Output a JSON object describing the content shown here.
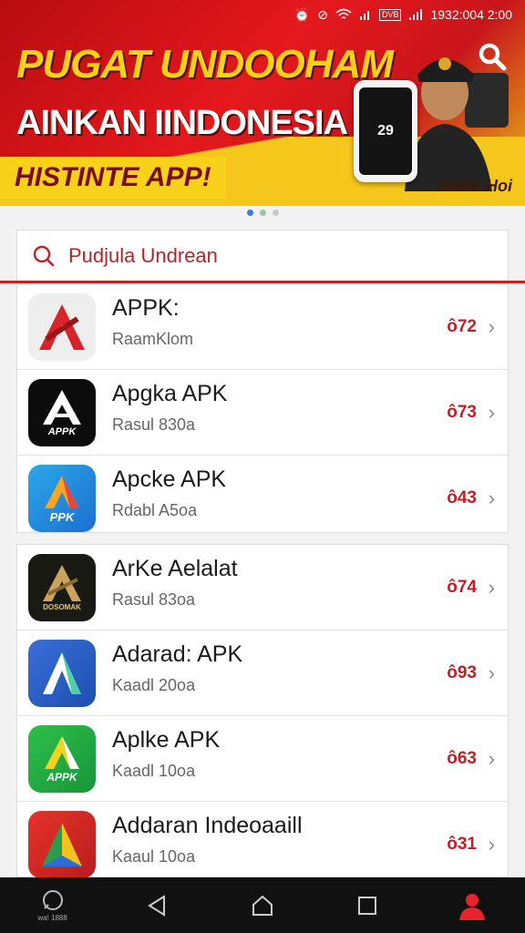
{
  "status_bar": {
    "time": "1932:004 2:00",
    "battery": "DVB"
  },
  "banner": {
    "title": "PUGAT UNDOOHAM",
    "subtitle": "AINKAN IINDONESIA",
    "tag": "HISTINTE APP!",
    "phone_text": "29",
    "brand": "Saeto Hoi",
    "colors": {
      "red": "#e4181d",
      "yellow": "#f8d21a"
    }
  },
  "carousel": {
    "pages": 3,
    "active": 1
  },
  "search": {
    "placeholder": "Pudjula Undrean",
    "icon": "search-icon"
  },
  "apps_group1": [
    {
      "name": "APPK:",
      "sub": "RaamKlom",
      "price": "ô72",
      "icon_text": ""
    },
    {
      "name": "Apgka APK",
      "sub": "Rasul 830a",
      "price": "ô73",
      "icon_text": "APPK"
    },
    {
      "name": "Apcke APK",
      "sub": "Rdabl A5oa",
      "price": "ô43",
      "icon_text": "PPK"
    }
  ],
  "apps_group2": [
    {
      "name": "ArKe Aelalat",
      "sub": "Rasul 83oa",
      "price": "ô74",
      "icon_text": "DOSOMAK"
    },
    {
      "name": "Adarad: APK",
      "sub": "Kaadl 20oa",
      "price": "ô93",
      "icon_text": ""
    },
    {
      "name": "Aplke APK",
      "sub": "Kaadl 10oa",
      "price": "ô63",
      "icon_text": "APPK"
    },
    {
      "name": "Addaran Indeoaaill",
      "sub": "Kaaul 10oa",
      "price": "ô31",
      "icon_text": ""
    }
  ],
  "navbar": {
    "home_caption": "wa! 1888"
  }
}
